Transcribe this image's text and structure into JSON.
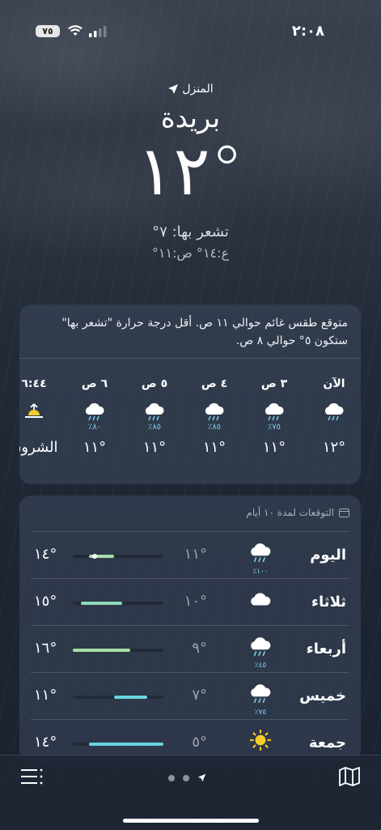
{
  "status": {
    "time": "٢:٠٨",
    "battery": "٧٥"
  },
  "location": {
    "label": "المنزل",
    "city": "بريدة",
    "temp": "١٢°",
    "feels_like": "تشعر بها: ٧°",
    "hilo": "ع:١٤° ص:١١°"
  },
  "hourly": {
    "summary": "متوقع طقس غائم حوالي ١١ ص. أقل درجة حرارة \"تشعر بها\" ستكون ٥° حوالي ٨ ص.",
    "items": [
      {
        "label": "الآن",
        "icon": "cloud-rain-icon",
        "pct": "",
        "temp": "١٢°"
      },
      {
        "label": "٣ ص",
        "icon": "cloud-rain-icon",
        "pct": "٧٥٪",
        "temp": "١١°"
      },
      {
        "label": "٤ ص",
        "icon": "cloud-rain-icon",
        "pct": "٨٥٪",
        "temp": "١١°"
      },
      {
        "label": "٥ ص",
        "icon": "cloud-rain-icon",
        "pct": "٨٥٪",
        "temp": "١١°"
      },
      {
        "label": "٦ ص",
        "icon": "cloud-rain-icon",
        "pct": "٨٠٪",
        "temp": "١١°"
      },
      {
        "label": "٦:٤٤",
        "icon": "sunrise-icon",
        "pct": "",
        "temp": "الشروق"
      }
    ]
  },
  "daily": {
    "title": "التوقعات لمدة ١٠ أيام",
    "range": [
      5,
      16
    ],
    "rows": [
      {
        "day": "اليوم",
        "icon": "cloud-rain-icon",
        "pct": "١٠٠٪",
        "low": "١١°",
        "high": "١٤°",
        "low_v": 11,
        "high_v": 14,
        "color": "#a6dfa6",
        "current": true
      },
      {
        "day": "ثلاثاء",
        "icon": "cloud-icon",
        "pct": "",
        "low": "١٠°",
        "high": "١٥°",
        "low_v": 10,
        "high_v": 15,
        "color": "#8fd9b8"
      },
      {
        "day": "أربعاء",
        "icon": "cloud-rain-icon",
        "pct": "٤٥٪",
        "low": "٩°",
        "high": "١٦°",
        "low_v": 9,
        "high_v": 16,
        "color": "#a6dfa6"
      },
      {
        "day": "خميس",
        "icon": "cloud-rain-icon",
        "pct": "٧٥٪",
        "low": "٧°",
        "high": "١١°",
        "low_v": 7,
        "high_v": 11,
        "color": "#68d3e0"
      },
      {
        "day": "جمعة",
        "icon": "sun-icon",
        "pct": "",
        "low": "٥°",
        "high": "١٤°",
        "low_v": 5,
        "high_v": 14,
        "color": "#68d3e0"
      }
    ]
  }
}
